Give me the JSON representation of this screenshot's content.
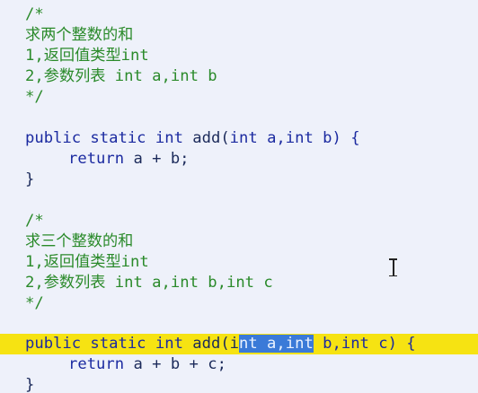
{
  "block1": {
    "comment_open": "/*",
    "comment_title": "求两个整数的和",
    "comment_return": "1,返回值类型int",
    "comment_params": "2,参数列表 int a,int b",
    "comment_close": "*/",
    "sig_modifiers": "public static int",
    "sig_name": " add(",
    "sig_params": "int a,int b) {",
    "body_return": "return",
    "body_expr": " a + b;",
    "close_brace": "}"
  },
  "block2": {
    "comment_open": "/*",
    "comment_title": "求三个整数的和",
    "comment_return": "1,返回值类型int",
    "comment_params": "2,参数列表 int a,int b,int c",
    "comment_close": "*/",
    "sig_modifiers": "public static int",
    "sig_name": " add(i",
    "sig_selected": "nt a,int",
    "sig_rest": " b,int c) {",
    "body_return": "return",
    "body_expr": " a + b + c;",
    "close_brace": "}"
  },
  "colors": {
    "background": "#eef1fa",
    "comment": "#2a8a2a",
    "keyword": "#1b2aa0",
    "current_line_highlight": "#f6e312",
    "selection": "#3a7ad8"
  },
  "mouse_cursor": "text-ibeam-cursor"
}
